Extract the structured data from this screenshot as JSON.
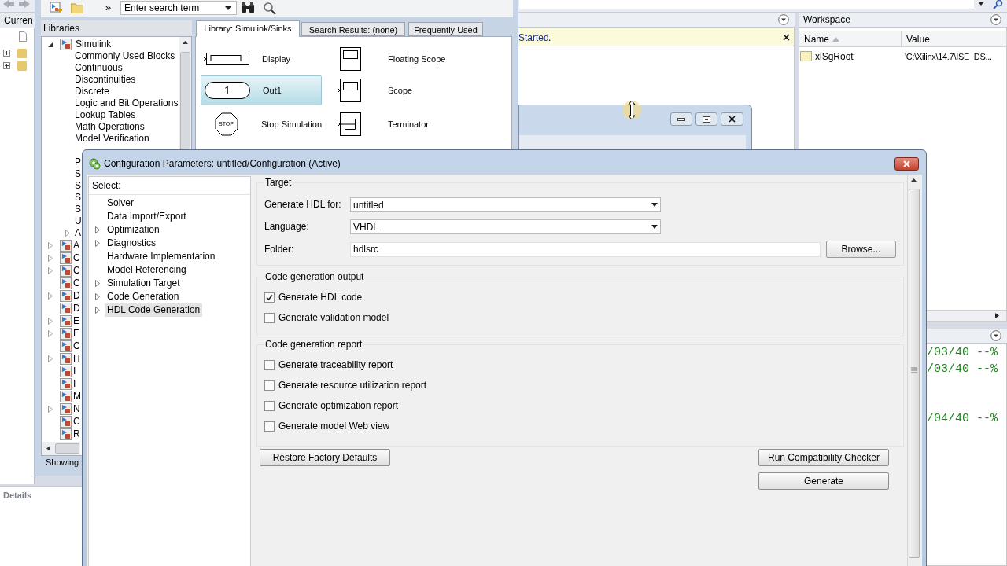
{
  "matlab": {
    "current_folder_tab": "Curren",
    "folders": [
      {
        "expanded": false
      },
      {
        "expanded": false
      }
    ],
    "details_label": "Details",
    "banner": {
      "link": "Started",
      "suffix": "."
    },
    "workspace": {
      "title": "Workspace",
      "columns": [
        {
          "label": "Name",
          "sorted": true
        },
        {
          "label": "Value",
          "sorted": false
        }
      ],
      "rows": [
        {
          "name": "xlSgRoot",
          "value": "'C:\\Xilinx\\14.7\\ISE_DS..."
        }
      ]
    },
    "command_lines": [
      {
        "text": "/03/40 --%"
      },
      {
        "text": "/03/40 --%"
      },
      {
        "text": "/04/40 --%"
      }
    ]
  },
  "library_browser": {
    "overflow": "»",
    "search_placeholder": "Enter search term",
    "pane_title": "Libraries",
    "tree": [
      {
        "label": "Simulink",
        "expanded": true,
        "children": [
          {
            "label": "Commonly Used Blocks",
            "expandable": false
          },
          {
            "label": "Continuous",
            "expandable": false
          },
          {
            "label": "Discontinuities",
            "expandable": false
          },
          {
            "label": "Discrete",
            "expandable": false
          },
          {
            "label": "Logic and Bit Operations",
            "expandable": false
          },
          {
            "label": "Lookup Tables",
            "expandable": false
          },
          {
            "label": "Math Operations",
            "expandable": false
          },
          {
            "label": "Model Verification",
            "expandable": false
          },
          {
            "label": "P",
            "expandable": false
          },
          {
            "label": "S",
            "expandable": false
          },
          {
            "label": "S",
            "expandable": false
          },
          {
            "label": "S",
            "expandable": false
          },
          {
            "label": "S",
            "expandable": false
          },
          {
            "label": "U",
            "expandable": false
          },
          {
            "label": "A",
            "expandable": true
          }
        ]
      },
      {
        "label": "A",
        "expandable": true
      },
      {
        "label": "C",
        "expandable": true
      },
      {
        "label": "C",
        "expandable": true
      },
      {
        "label": "C",
        "expandable": false
      },
      {
        "label": "D",
        "expandable": true
      },
      {
        "label": "D",
        "expandable": false
      },
      {
        "label": "E",
        "expandable": true
      },
      {
        "label": "F",
        "expandable": true
      },
      {
        "label": "C",
        "expandable": false
      },
      {
        "label": "H",
        "expandable": true
      },
      {
        "label": "I",
        "expandable": false
      },
      {
        "label": "I",
        "expandable": false
      },
      {
        "label": "M",
        "expandable": false
      },
      {
        "label": "N",
        "expandable": true
      },
      {
        "label": "C",
        "expandable": false
      },
      {
        "label": "R",
        "expandable": false
      }
    ],
    "tabs": [
      {
        "label": "Library: Simulink/Sinks",
        "selected": true
      },
      {
        "label": "Search Results: (none)",
        "selected": false
      },
      {
        "label": "Frequently Used",
        "selected": false
      }
    ],
    "blocks": [
      {
        "label": "Display",
        "kind": "display",
        "selected": false
      },
      {
        "label": "Floating Scope",
        "kind": "floating_scope",
        "selected": false
      },
      {
        "label": "Out1",
        "kind": "outport",
        "port_number": "1",
        "selected": true
      },
      {
        "label": "Scope",
        "kind": "scope",
        "selected": false
      },
      {
        "label": "Stop Simulation",
        "kind": "stop",
        "stop_text": "STOP",
        "selected": false
      },
      {
        "label": "Terminator",
        "kind": "terminator",
        "selected": false
      }
    ],
    "status": "Showing"
  },
  "config": {
    "title": "Configuration Parameters: untitled/Configuration (Active)",
    "select_label": "Select:",
    "tree": [
      {
        "label": "Solver",
        "expandable": false,
        "selected": false
      },
      {
        "label": "Data Import/Export",
        "expandable": false,
        "selected": false
      },
      {
        "label": "Optimization",
        "expandable": true,
        "selected": false
      },
      {
        "label": "Diagnostics",
        "expandable": true,
        "selected": false
      },
      {
        "label": "Hardware Implementation",
        "expandable": false,
        "selected": false
      },
      {
        "label": "Model Referencing",
        "expandable": false,
        "selected": false
      },
      {
        "label": "Simulation Target",
        "expandable": true,
        "selected": false
      },
      {
        "label": "Code Generation",
        "expandable": true,
        "selected": false
      },
      {
        "label": "HDL Code Generation",
        "expandable": true,
        "selected": true
      }
    ],
    "target": {
      "heading": "Target",
      "fields": [
        {
          "label": "Generate HDL for:",
          "kind": "dropdown",
          "value": "untitled"
        },
        {
          "label": "Language:",
          "kind": "dropdown",
          "value": "VHDL"
        },
        {
          "label": "Folder:",
          "kind": "text",
          "value": "hdlsrc",
          "button": "Browse..."
        }
      ]
    },
    "sections": [
      {
        "heading": "Code generation output",
        "options": [
          {
            "label": "Generate HDL code",
            "checked": true
          },
          {
            "label": "Generate validation model",
            "checked": false
          }
        ]
      },
      {
        "heading": "Code generation report",
        "options": [
          {
            "label": "Generate traceability report",
            "checked": false
          },
          {
            "label": "Generate resource utilization report",
            "checked": false
          },
          {
            "label": "Generate optimization report",
            "checked": false
          },
          {
            "label": "Generate model Web view",
            "checked": false
          }
        ]
      }
    ],
    "restore_button": "Restore Factory Defaults",
    "check_button": "Run Compatibility Checker",
    "generate_button": "Generate"
  }
}
